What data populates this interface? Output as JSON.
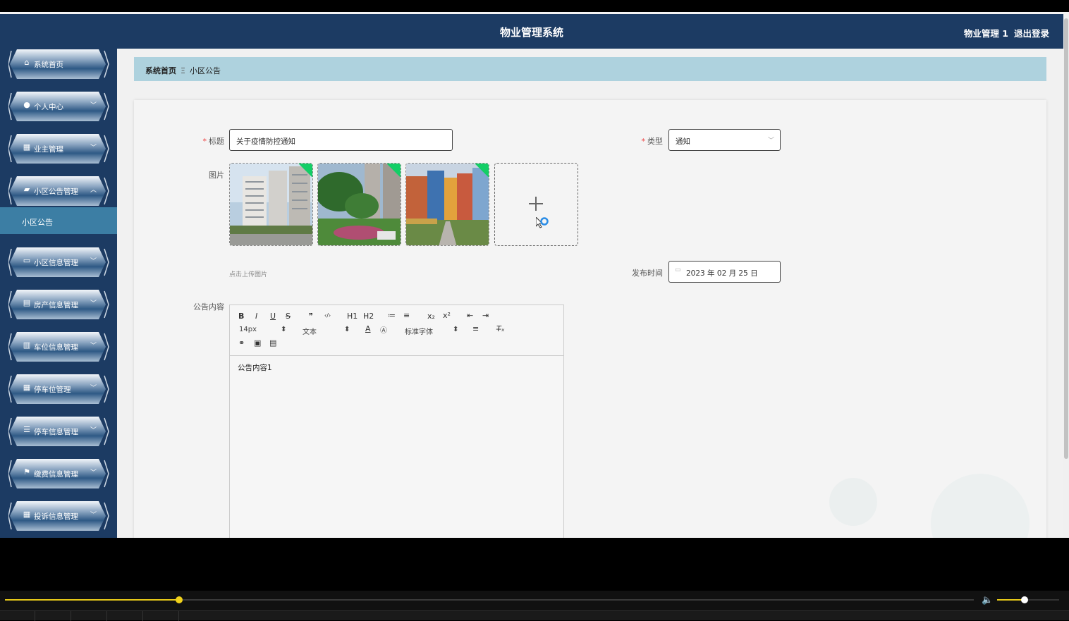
{
  "header": {
    "title": "物业管理系统",
    "user": "物业管理 1",
    "logout": "退出登录"
  },
  "sidebar": {
    "items": [
      {
        "label": "系统首页",
        "icon": "home-icon",
        "glyph": "⌂",
        "expandable": false
      },
      {
        "label": "个人中心",
        "icon": "user-icon",
        "glyph": "●",
        "expandable": true
      },
      {
        "label": "业主管理",
        "icon": "grid-icon",
        "glyph": "▦",
        "expandable": true
      },
      {
        "label": "小区公告管理",
        "icon": "briefcase-icon",
        "glyph": "▰",
        "expandable": true,
        "expanded": true
      },
      {
        "label": "小区信息管理",
        "icon": "monitor-icon",
        "glyph": "▭",
        "expandable": true
      },
      {
        "label": "房产信息管理",
        "icon": "document-icon",
        "glyph": "▤",
        "expandable": true
      },
      {
        "label": "车位信息管理",
        "icon": "clipboard-icon",
        "glyph": "▥",
        "expandable": true
      },
      {
        "label": "停车位管理",
        "icon": "grid-icon",
        "glyph": "▦",
        "expandable": true
      },
      {
        "label": "停车信息管理",
        "icon": "list-icon",
        "glyph": "☰",
        "expandable": true
      },
      {
        "label": "缴费信息管理",
        "icon": "flag-icon",
        "glyph": "⚑",
        "expandable": true
      },
      {
        "label": "投诉信息管理",
        "icon": "grid-icon",
        "glyph": "▦",
        "expandable": true
      }
    ],
    "submenu": {
      "label": "小区公告"
    }
  },
  "breadcrumb": {
    "home": "系统首页",
    "separator": "Ξ",
    "current": "小区公告"
  },
  "form": {
    "title_label": "标题",
    "title_value": "关于疫情防控通知",
    "type_label": "类型",
    "type_value": "通知",
    "image_label": "图片",
    "upload_hint": "点击上传图片",
    "date_label": "发布时间",
    "date_value": "2023 年 02 月 25 日",
    "content_label": "公告内容",
    "content_value": "公告内容1",
    "images_count": 3
  },
  "editor_toolbar": {
    "row1": [
      "B",
      "I",
      "U",
      "S",
      "❞",
      "‹/›",
      "H1",
      "H2",
      "≔",
      "≡",
      "x₂",
      "x²",
      "⇤",
      "⇥"
    ],
    "font_size": "14px",
    "paragraph": "文本",
    "font_family": "标准字体"
  },
  "video": {
    "progress": 0.18,
    "volume": 0.44
  },
  "colors": {
    "header": "#1c3b63",
    "submenu_active": "#3c7ea4",
    "breadcrumb": "#aed2de",
    "success": "#13ce66",
    "progress": "#e6c819"
  }
}
